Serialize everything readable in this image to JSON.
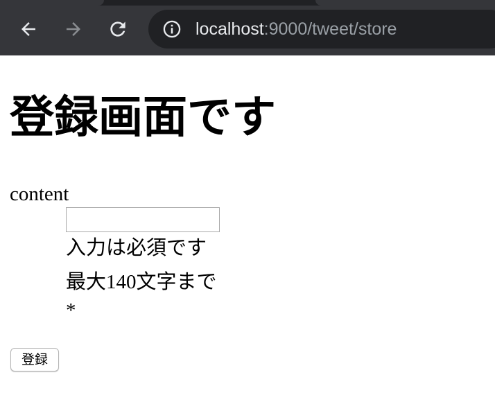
{
  "browser": {
    "url_host": "localhost",
    "url_rest": ":9000/tweet/store",
    "icons": {
      "back": "back-arrow-icon",
      "forward": "forward-arrow-icon",
      "reload": "reload-icon",
      "site_info": "info-icon"
    },
    "colors": {
      "toolbar": "#35363a",
      "omnibox": "#202124",
      "url_host": "#e8eaed",
      "url_rest": "#9aa0a6"
    }
  },
  "page": {
    "title": "登録画面です",
    "form": {
      "content_label": "content",
      "content_value": "",
      "required_note": "入力は必須です",
      "max_note": "最大140文字まで",
      "required_mark": "*",
      "submit_label": "登録"
    }
  }
}
